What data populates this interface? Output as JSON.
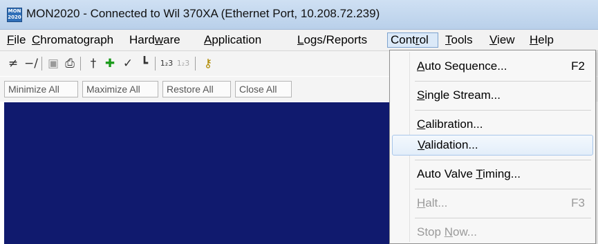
{
  "window": {
    "title": "MON2020 - Connected to Wil 370XA (Ethernet Port, 10.208.72.239)",
    "icon_text": "MON 2020"
  },
  "menubar": [
    {
      "pre": "",
      "u": "F",
      "post": "ile"
    },
    {
      "pre": "",
      "u": "C",
      "post": "hromatograph"
    },
    {
      "pre": "Hard",
      "u": "w",
      "post": "are"
    },
    {
      "pre": "",
      "u": "A",
      "post": "pplication"
    },
    {
      "pre": "",
      "u": "L",
      "post": "ogs/Reports"
    },
    {
      "pre": "Cont",
      "u": "r",
      "post": "ol"
    },
    {
      "pre": "",
      "u": "T",
      "post": "ools"
    },
    {
      "pre": "",
      "u": "V",
      "post": "iew"
    },
    {
      "pre": "",
      "u": "H",
      "post": "elp"
    }
  ],
  "toolbar_icons": [
    "connect-icon",
    "disconnect-icon",
    "open-icon",
    "print-icon",
    "chromatogram-icon",
    "valve-icon",
    "check-icon",
    "baseline-icon",
    "number-123-icon",
    "number-123-disabled-icon",
    "key-icon"
  ],
  "window_buttons": {
    "minimize_all": "Minimize All",
    "maximize_all": "Maximize All",
    "restore_all": "Restore All",
    "close_all": "Close All"
  },
  "control_menu": {
    "auto_sequence": {
      "pre": "",
      "u": "A",
      "post": "uto Sequence...",
      "shortcut": "F2"
    },
    "single_stream": {
      "pre": "",
      "u": "S",
      "post": "ingle Stream..."
    },
    "calibration": {
      "pre": "",
      "u": "C",
      "post": "alibration..."
    },
    "validation": {
      "pre": "",
      "u": "V",
      "post": "alidation..."
    },
    "auto_valve_timing": {
      "pre": "Auto Valve ",
      "u": "T",
      "post": "iming..."
    },
    "halt": {
      "pre": "",
      "u": "H",
      "post": "alt...",
      "shortcut": "F3"
    },
    "stop_now": {
      "pre": "Stop ",
      "u": "N",
      "post": "ow..."
    }
  },
  "colors": {
    "mdi_background": "#101a6e",
    "highlight": "#e3eefa"
  }
}
